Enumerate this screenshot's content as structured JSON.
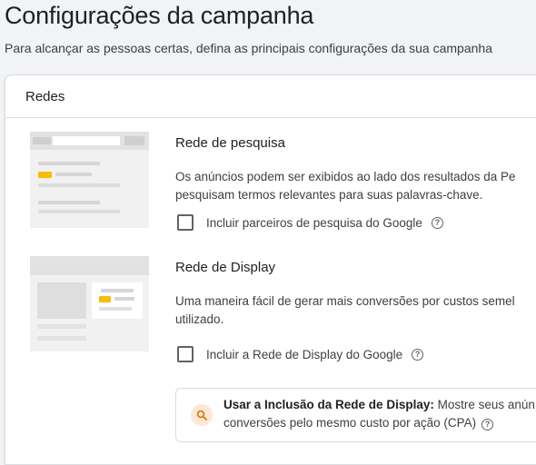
{
  "page": {
    "title": "Configurações da campanha",
    "subtitle": "Para alcançar as pessoas certas, defina as principais configurações da sua campanha"
  },
  "card": {
    "header_title": "Redes"
  },
  "search_network": {
    "title": "Rede de pesquisa",
    "desc_line1": "Os anúncios podem ser exibidos ao lado dos resultados da Pe",
    "desc_line2": "pesquisam termos relevantes para suas palavras-chave.",
    "checkbox_label": "Incluir parceiros de pesquisa do Google",
    "checked": false
  },
  "display_network": {
    "title": "Rede de Display",
    "desc_line1": "Uma maneira fácil de gerar mais conversões por custos semel",
    "desc_line2": "utilizado.",
    "checkbox_label": "Incluir a Rede de Display do Google",
    "checked": false
  },
  "info_box": {
    "bold_text": "Usar a Inclusão da Rede de Display:",
    "text_line1_rest": " Mostre seus anún",
    "text_line2": "conversões pelo mesmo custo por ação (CPA)"
  },
  "colors": {
    "accent_yellow": "#fbbc04",
    "illustration_bg": "#f1f1f1",
    "info_icon_bg": "#fce8d6",
    "info_icon_fg": "#e37400"
  },
  "icons": {
    "help": "help-circle-icon",
    "info": "search-icon"
  }
}
